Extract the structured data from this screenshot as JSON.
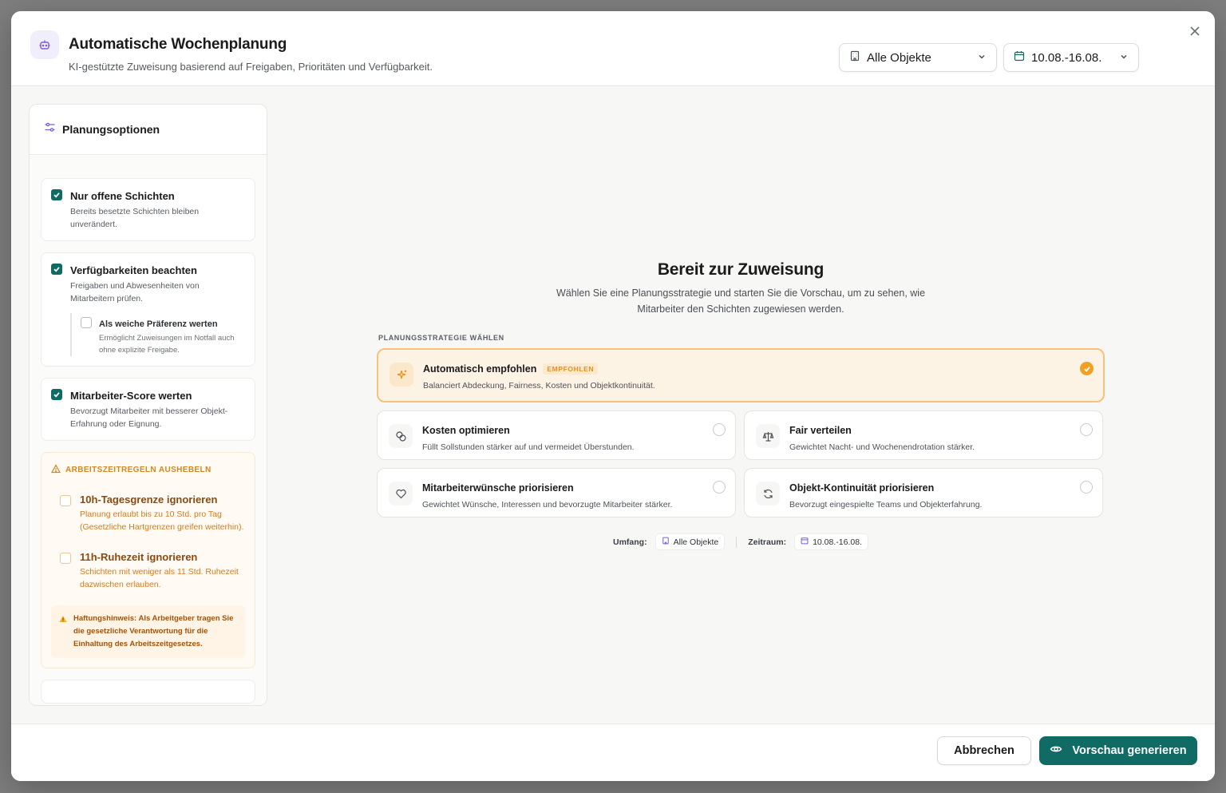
{
  "header": {
    "title": "Automatische Wochenplanung",
    "subtitle": "KI-gestützte Zuweisung basierend auf Freigaben, Prioritäten und Verfügbarkeit.",
    "object_select": "Alle Objekte",
    "date_select": "10.08.-16.08."
  },
  "left": {
    "title": "Planungsoptionen",
    "options": [
      {
        "title": "Nur offene Schichten",
        "desc": "Bereits besetzte Schichten bleiben unverändert.",
        "checked": true
      },
      {
        "title": "Verfügbarkeiten beachten",
        "desc": "Freigaben und Abwesenheiten von Mitarbeitern prüfen.",
        "checked": true,
        "sub": {
          "title": "Als weiche Präferenz werten",
          "desc": "Ermöglicht Zuweisungen im Notfall auch ohne explizite Freigabe.",
          "checked": false
        }
      },
      {
        "title": "Mitarbeiter-Score werten",
        "desc": "Bevorzugt Mitarbeiter mit besserer Objekt-Erfahrung oder Eignung.",
        "checked": true
      }
    ],
    "warning": {
      "heading": "ARBEITSZEITREGELN AUSHEBELN",
      "items": [
        {
          "title": "10h-Tagesgrenze ignorieren",
          "desc": "Planung erlaubt bis zu 10 Std. pro Tag (Gesetzliche Hartgrenzen greifen weiterhin).",
          "checked": false
        },
        {
          "title": "11h-Ruhezeit ignorieren",
          "desc": "Schichten mit weniger als 11 Std. Ruhezeit dazwischen erlauben.",
          "checked": false
        }
      ],
      "liability": "Haftungshinweis: Als Arbeitgeber tragen Sie die gesetzliche Verantwortung für die Einhaltung des Arbeitszeitgesetzes."
    }
  },
  "main": {
    "title": "Bereit zur Zuweisung",
    "subtitle": "Wählen Sie eine Planungsstrategie und starten Sie die Vorschau, um zu sehen, wie Mitarbeiter den Schichten zugewiesen werden.",
    "strategy_label": "PLANUNGSSTRATEGIE WÄHLEN",
    "strategies": [
      {
        "title": "Automatisch empfohlen",
        "badge": "EMPFOHLEN",
        "desc": "Balanciert Abdeckung, Fairness, Kosten und Objektkontinuität.",
        "selected": true,
        "icon": "sparkles-icon"
      },
      {
        "title": "Kosten optimieren",
        "desc": "Füllt Sollstunden stärker auf und vermeidet Überstunden.",
        "selected": false,
        "icon": "coins-icon"
      },
      {
        "title": "Fair verteilen",
        "desc": "Gewichtet Nacht- und Wochenendrotation stärker.",
        "selected": false,
        "icon": "scale-icon"
      },
      {
        "title": "Mitarbeiterwünsche priorisieren",
        "desc": "Gewichtet Wünsche, Interessen und bevorzugte Mitarbeiter stärker.",
        "selected": false,
        "icon": "heart-icon"
      },
      {
        "title": "Objekt-Kontinuität priorisieren",
        "desc": "Bevorzugt eingespielte Teams und Objekterfahrung.",
        "selected": false,
        "icon": "refresh-icon"
      }
    ],
    "scope_label": "Umfang:",
    "scope_value": "Alle Objekte",
    "period_label": "Zeitraum:",
    "period_value": "10.08.-16.08."
  },
  "footer": {
    "cancel": "Abbrechen",
    "primary": "Vorschau generieren"
  },
  "colors": {
    "primary": "#0f6b63",
    "accent_orange": "#f0a124",
    "warning_text": "#d5861e",
    "selected_bg": "#fdf3e5"
  }
}
